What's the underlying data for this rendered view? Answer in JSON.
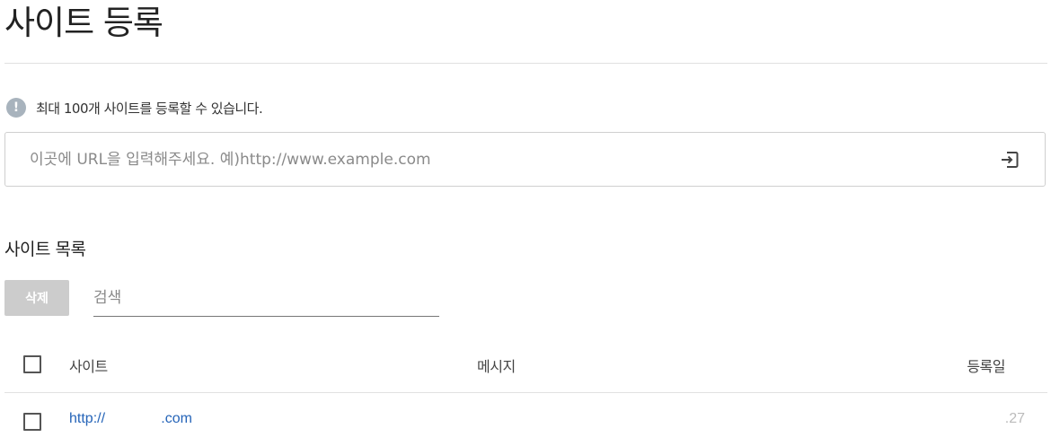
{
  "page": {
    "title": "사이트 등록",
    "notice": "최대 100개 사이트를 등록할 수 있습니다."
  },
  "url_input": {
    "placeholder": "이곳에 URL을 입력해주세요. 예)http://www.example.com",
    "value": "",
    "submit_icon": "enter-icon"
  },
  "site_list": {
    "title": "사이트 목록",
    "delete_label": "삭제",
    "search_placeholder": "검색",
    "columns": {
      "site": "사이트",
      "message": "메시지",
      "date": "등록일"
    },
    "rows": [
      {
        "site": "http://              .com",
        "message": "",
        "date": ".27",
        "checked": false
      }
    ]
  },
  "colors": {
    "link": "#2564b8",
    "disabled_button": "#cccccc",
    "info_icon": "#a8b3bd"
  }
}
